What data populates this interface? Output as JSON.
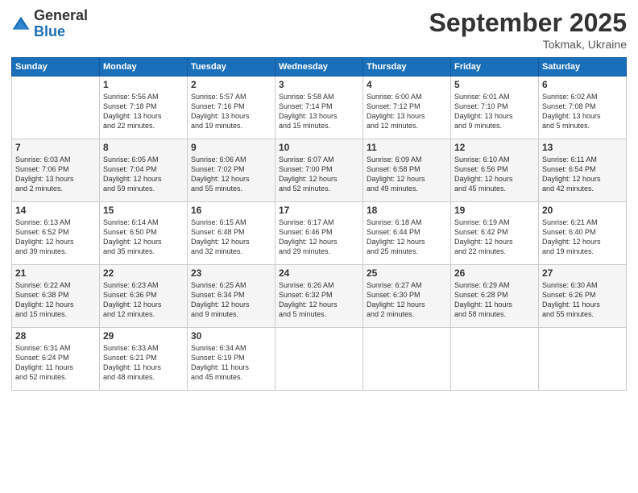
{
  "header": {
    "logo": {
      "general": "General",
      "blue": "Blue"
    },
    "title": "September 2025",
    "location": "Tokmak, Ukraine"
  },
  "weekdays": [
    "Sunday",
    "Monday",
    "Tuesday",
    "Wednesday",
    "Thursday",
    "Friday",
    "Saturday"
  ],
  "weeks": [
    [
      {
        "day": "",
        "info": ""
      },
      {
        "day": "1",
        "info": "Sunrise: 5:56 AM\nSunset: 7:18 PM\nDaylight: 13 hours\nand 22 minutes."
      },
      {
        "day": "2",
        "info": "Sunrise: 5:57 AM\nSunset: 7:16 PM\nDaylight: 13 hours\nand 19 minutes."
      },
      {
        "day": "3",
        "info": "Sunrise: 5:58 AM\nSunset: 7:14 PM\nDaylight: 13 hours\nand 15 minutes."
      },
      {
        "day": "4",
        "info": "Sunrise: 6:00 AM\nSunset: 7:12 PM\nDaylight: 13 hours\nand 12 minutes."
      },
      {
        "day": "5",
        "info": "Sunrise: 6:01 AM\nSunset: 7:10 PM\nDaylight: 13 hours\nand 9 minutes."
      },
      {
        "day": "6",
        "info": "Sunrise: 6:02 AM\nSunset: 7:08 PM\nDaylight: 13 hours\nand 5 minutes."
      }
    ],
    [
      {
        "day": "7",
        "info": "Sunrise: 6:03 AM\nSunset: 7:06 PM\nDaylight: 13 hours\nand 2 minutes."
      },
      {
        "day": "8",
        "info": "Sunrise: 6:05 AM\nSunset: 7:04 PM\nDaylight: 12 hours\nand 59 minutes."
      },
      {
        "day": "9",
        "info": "Sunrise: 6:06 AM\nSunset: 7:02 PM\nDaylight: 12 hours\nand 55 minutes."
      },
      {
        "day": "10",
        "info": "Sunrise: 6:07 AM\nSunset: 7:00 PM\nDaylight: 12 hours\nand 52 minutes."
      },
      {
        "day": "11",
        "info": "Sunrise: 6:09 AM\nSunset: 6:58 PM\nDaylight: 12 hours\nand 49 minutes."
      },
      {
        "day": "12",
        "info": "Sunrise: 6:10 AM\nSunset: 6:56 PM\nDaylight: 12 hours\nand 45 minutes."
      },
      {
        "day": "13",
        "info": "Sunrise: 6:11 AM\nSunset: 6:54 PM\nDaylight: 12 hours\nand 42 minutes."
      }
    ],
    [
      {
        "day": "14",
        "info": "Sunrise: 6:13 AM\nSunset: 6:52 PM\nDaylight: 12 hours\nand 39 minutes."
      },
      {
        "day": "15",
        "info": "Sunrise: 6:14 AM\nSunset: 6:50 PM\nDaylight: 12 hours\nand 35 minutes."
      },
      {
        "day": "16",
        "info": "Sunrise: 6:15 AM\nSunset: 6:48 PM\nDaylight: 12 hours\nand 32 minutes."
      },
      {
        "day": "17",
        "info": "Sunrise: 6:17 AM\nSunset: 6:46 PM\nDaylight: 12 hours\nand 29 minutes."
      },
      {
        "day": "18",
        "info": "Sunrise: 6:18 AM\nSunset: 6:44 PM\nDaylight: 12 hours\nand 25 minutes."
      },
      {
        "day": "19",
        "info": "Sunrise: 6:19 AM\nSunset: 6:42 PM\nDaylight: 12 hours\nand 22 minutes."
      },
      {
        "day": "20",
        "info": "Sunrise: 6:21 AM\nSunset: 6:40 PM\nDaylight: 12 hours\nand 19 minutes."
      }
    ],
    [
      {
        "day": "21",
        "info": "Sunrise: 6:22 AM\nSunset: 6:38 PM\nDaylight: 12 hours\nand 15 minutes."
      },
      {
        "day": "22",
        "info": "Sunrise: 6:23 AM\nSunset: 6:36 PM\nDaylight: 12 hours\nand 12 minutes."
      },
      {
        "day": "23",
        "info": "Sunrise: 6:25 AM\nSunset: 6:34 PM\nDaylight: 12 hours\nand 9 minutes."
      },
      {
        "day": "24",
        "info": "Sunrise: 6:26 AM\nSunset: 6:32 PM\nDaylight: 12 hours\nand 5 minutes."
      },
      {
        "day": "25",
        "info": "Sunrise: 6:27 AM\nSunset: 6:30 PM\nDaylight: 12 hours\nand 2 minutes."
      },
      {
        "day": "26",
        "info": "Sunrise: 6:29 AM\nSunset: 6:28 PM\nDaylight: 11 hours\nand 58 minutes."
      },
      {
        "day": "27",
        "info": "Sunrise: 6:30 AM\nSunset: 6:26 PM\nDaylight: 11 hours\nand 55 minutes."
      }
    ],
    [
      {
        "day": "28",
        "info": "Sunrise: 6:31 AM\nSunset: 6:24 PM\nDaylight: 11 hours\nand 52 minutes."
      },
      {
        "day": "29",
        "info": "Sunrise: 6:33 AM\nSunset: 6:21 PM\nDaylight: 11 hours\nand 48 minutes."
      },
      {
        "day": "30",
        "info": "Sunrise: 6:34 AM\nSunset: 6:19 PM\nDaylight: 11 hours\nand 45 minutes."
      },
      {
        "day": "",
        "info": ""
      },
      {
        "day": "",
        "info": ""
      },
      {
        "day": "",
        "info": ""
      },
      {
        "day": "",
        "info": ""
      }
    ]
  ]
}
